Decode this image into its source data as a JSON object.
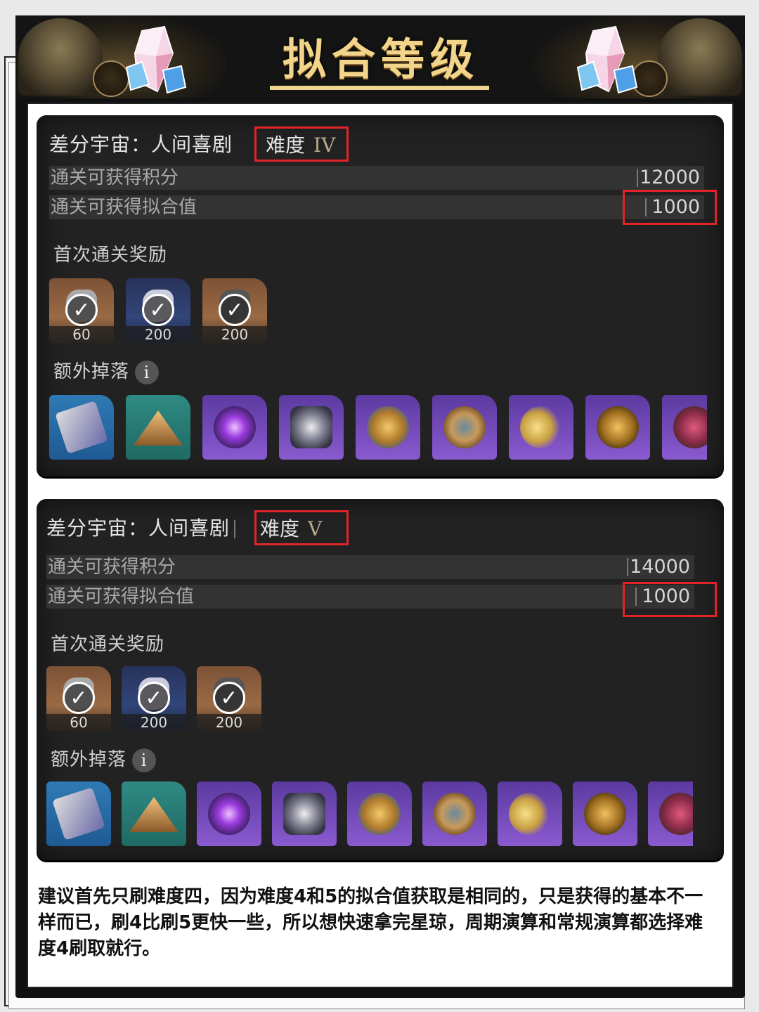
{
  "page_title": "拟合等级",
  "panels": [
    {
      "mode_label": "差分宇宙：人间喜剧",
      "difficulty_label": "难度",
      "difficulty_roman": "IV",
      "score_label": "通关可获得积分",
      "score_value": "12000",
      "fit_label": "通关可获得拟合值",
      "fit_value": "1000",
      "first_clear_label": "首次通关奖励",
      "first_clear_rewards": [
        {
          "icon": "stellar-jade-icon",
          "qty": "60",
          "claimed": true
        },
        {
          "icon": "star-rail-pass-icon",
          "qty": "200",
          "claimed": true
        },
        {
          "icon": "cosmic-fragment-icon",
          "qty": "200",
          "claimed": true
        }
      ],
      "extra_drop_label": "额外掉落",
      "info_glyph": "i",
      "extra_drops": [
        "card-icon",
        "sand-pile-icon",
        "void-orb-icon",
        "mech-relic-icon",
        "star-medal-icon",
        "armored-sphere-icon",
        "golden-moon-icon",
        "golden-globe-icon",
        "crimson-relic-icon"
      ]
    },
    {
      "mode_label": "差分宇宙：人间喜剧",
      "difficulty_label": "难度",
      "difficulty_roman": "V",
      "score_label": "通关可获得积分",
      "score_value": "14000",
      "fit_label": "通关可获得拟合值",
      "fit_value": "1000",
      "first_clear_label": "首次通关奖励",
      "first_clear_rewards": [
        {
          "icon": "stellar-jade-icon",
          "qty": "60",
          "claimed": true
        },
        {
          "icon": "star-rail-pass-icon",
          "qty": "200",
          "claimed": true
        },
        {
          "icon": "cosmic-fragment-icon",
          "qty": "200",
          "claimed": true
        }
      ],
      "extra_drop_label": "额外掉落",
      "info_glyph": "i",
      "extra_drops": [
        "card-icon",
        "sand-pile-icon",
        "void-orb-icon",
        "mech-relic-icon",
        "star-medal-icon",
        "armored-sphere-icon",
        "golden-moon-icon",
        "golden-globe-icon",
        "crimson-relic-icon"
      ]
    }
  ],
  "note": "建议首先只刷难度四，因为难度4和5的拟合值获取是相同的，只是获得的基本不一样而已，刷4比刷5更快一些，所以想快速拿完星琼，周期演算和常规演算都选择难度4刷取就行。",
  "colors": {
    "accent_gold": "#f2d58a",
    "highlight_red": "#e0242a",
    "panel_bg": "#222222"
  }
}
